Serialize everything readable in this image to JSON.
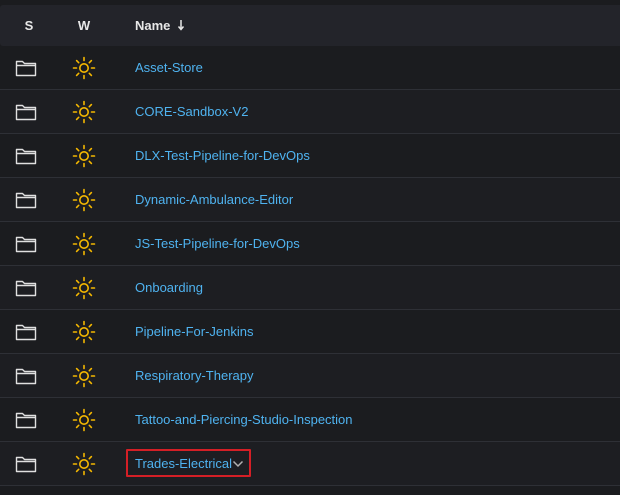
{
  "header": {
    "col_s": "S",
    "col_w": "W",
    "col_name": "Name",
    "sort": "descending-arrow-icon"
  },
  "rows": [
    {
      "name": "Asset-Store",
      "s_icon": "folder-icon",
      "w_icon": "sun-icon"
    },
    {
      "name": "CORE-Sandbox-V2",
      "s_icon": "folder-icon",
      "w_icon": "sun-icon"
    },
    {
      "name": "DLX-Test-Pipeline-for-DevOps",
      "s_icon": "folder-icon",
      "w_icon": "sun-icon"
    },
    {
      "name": "Dynamic-Ambulance-Editor",
      "s_icon": "folder-icon",
      "w_icon": "sun-icon"
    },
    {
      "name": "JS-Test-Pipeline-for-DevOps",
      "s_icon": "folder-icon",
      "w_icon": "sun-icon"
    },
    {
      "name": "Onboarding",
      "s_icon": "folder-icon",
      "w_icon": "sun-icon"
    },
    {
      "name": "Pipeline-For-Jenkins",
      "s_icon": "folder-icon",
      "w_icon": "sun-icon"
    },
    {
      "name": "Respiratory-Therapy",
      "s_icon": "folder-icon",
      "w_icon": "sun-icon"
    },
    {
      "name": "Tattoo-and-Piercing-Studio-Inspection",
      "s_icon": "folder-icon",
      "w_icon": "sun-icon"
    },
    {
      "name": "Trades-Electrical",
      "s_icon": "folder-icon",
      "w_icon": "sun-icon",
      "selected": true,
      "dropdown_icon": "chevron-down-icon"
    }
  ],
  "colors": {
    "link": "#4fb3f0",
    "sun": "#f5b800",
    "highlight_border": "#d41f26",
    "background": "#1b1c1f",
    "header_bg": "#23242a"
  }
}
